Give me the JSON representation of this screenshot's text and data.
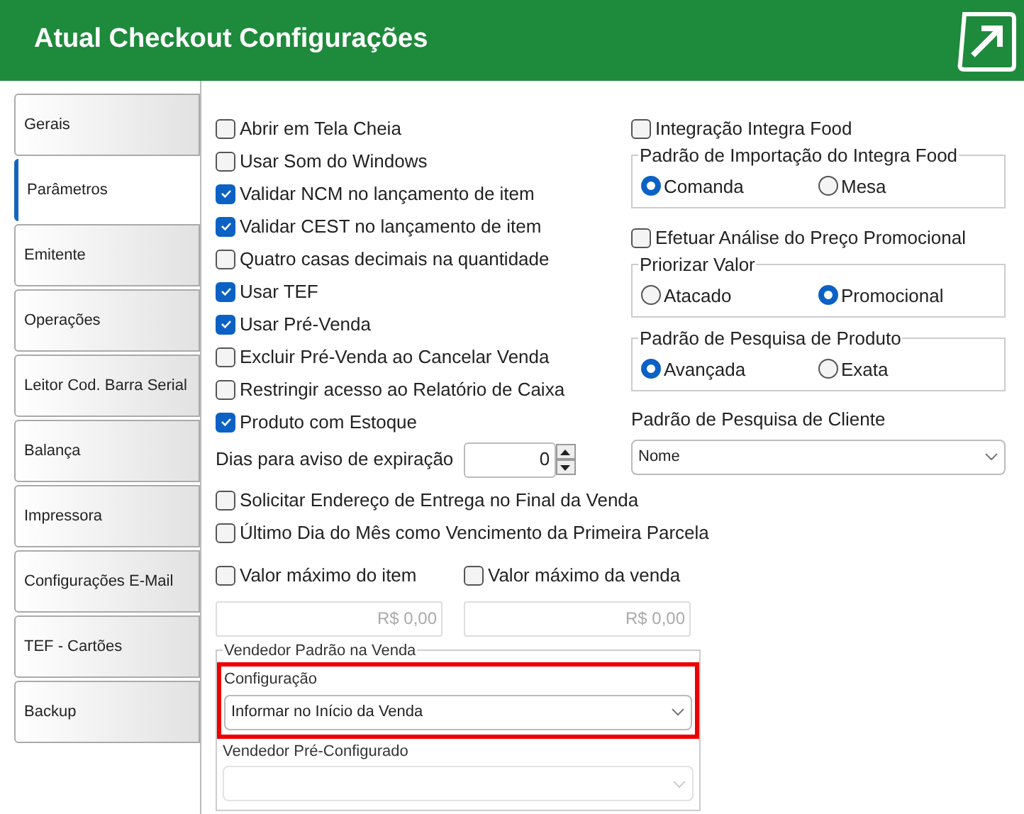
{
  "header": {
    "title": "Atual Checkout Configurações"
  },
  "sidebar": {
    "items": [
      {
        "label": "Gerais",
        "selected": false
      },
      {
        "label": "Parâmetros",
        "selected": true
      },
      {
        "label": "Emitente",
        "selected": false
      },
      {
        "label": "Operações",
        "selected": false
      },
      {
        "label": "Leitor Cod. Barra Serial",
        "selected": false
      },
      {
        "label": "Balança",
        "selected": false
      },
      {
        "label": "Impressora",
        "selected": false
      },
      {
        "label": "Configurações E-Mail",
        "selected": false
      },
      {
        "label": "TEF - Cartões",
        "selected": false
      },
      {
        "label": "Backup",
        "selected": false
      }
    ]
  },
  "left_options": [
    {
      "kind": "checkbox",
      "label": "Abrir em Tela Cheia",
      "checked": false
    },
    {
      "kind": "checkbox",
      "label": "Usar Som do Windows",
      "checked": false
    },
    {
      "kind": "checkbox",
      "label": "Validar NCM no lançamento de item",
      "checked": true
    },
    {
      "kind": "checkbox",
      "label": "Validar CEST no lançamento de item",
      "checked": true
    },
    {
      "kind": "checkbox",
      "label": "Quatro casas decimais na quantidade",
      "checked": false
    },
    {
      "kind": "checkbox",
      "label": "Usar TEF",
      "checked": true
    },
    {
      "kind": "checkbox",
      "label": "Usar Pré-Venda",
      "checked": true
    },
    {
      "kind": "checkbox",
      "label": "Excluir Pré-Venda ao Cancelar Venda",
      "checked": false
    },
    {
      "kind": "checkbox",
      "label": "Restringir acesso ao Relatório de Caixa",
      "checked": false
    },
    {
      "kind": "checkbox",
      "label": "Produto com Estoque",
      "checked": true
    },
    {
      "kind": "number",
      "label": "Dias para aviso de expiração",
      "value": "0"
    }
  ],
  "right_options": [
    {
      "kind": "checkbox",
      "label": "Integração Integra Food",
      "checked": false
    },
    {
      "kind": "radio_group",
      "legend": "Padrão de Importação do Integra Food",
      "options": [
        {
          "label": "Comanda",
          "selected": true
        },
        {
          "label": "Mesa",
          "selected": false
        }
      ]
    },
    {
      "kind": "checkbox",
      "label": "Efetuar Análise do Preço Promocional",
      "checked": false
    },
    {
      "kind": "radio_group",
      "legend": "Priorizar Valor",
      "options": [
        {
          "label": "Atacado",
          "selected": false
        },
        {
          "label": "Promocional",
          "selected": true
        }
      ]
    },
    {
      "kind": "radio_group",
      "legend": "Padrão de Pesquisa de Produto",
      "options": [
        {
          "label": "Avançada",
          "selected": true
        },
        {
          "label": "Exata",
          "selected": false
        }
      ]
    },
    {
      "kind": "select",
      "label": "Padrão de Pesquisa de Cliente",
      "value": "Nome"
    }
  ],
  "wide_options": [
    {
      "label": "Solicitar Endereço de Entrega no Final da Venda",
      "checked": false
    },
    {
      "label": "Último Dia do Mês como Vencimento da Primeira Parcela",
      "checked": false
    }
  ],
  "max_values": [
    {
      "label": "Valor máximo do item",
      "checked": false,
      "placeholder": "R$ 0,00"
    },
    {
      "label": "Valor máximo da venda",
      "checked": false,
      "placeholder": "R$ 0,00"
    }
  ],
  "seller": {
    "legend": "Vendedor Padrão na Venda",
    "fields": [
      {
        "label": "Configuração",
        "value": "Informar no Início da Venda",
        "highlighted": true,
        "disabled": false
      },
      {
        "label": "Vendedor Pré-Configurado",
        "highlighted": false,
        "disabled": true
      }
    ]
  }
}
